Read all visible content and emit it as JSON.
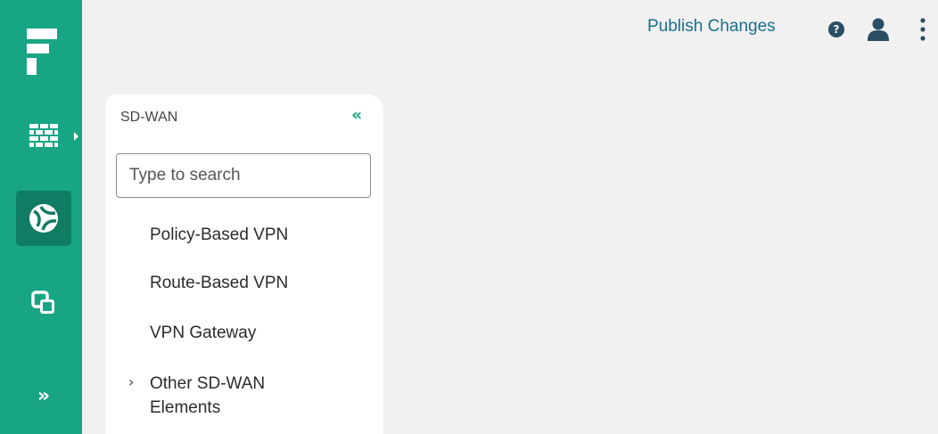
{
  "app": {
    "accent_color": "#17a584",
    "rail_active_color": "#107c63",
    "link_color": "#1a6f8c"
  },
  "rail": {
    "logo_icon": "forcepoint-logo-icon",
    "items": [
      {
        "icon": "firewall-icon",
        "active": false
      },
      {
        "icon": "globe-icon",
        "active": true
      },
      {
        "icon": "copy-icon",
        "active": false
      }
    ],
    "expand_label": "»"
  },
  "topbar": {
    "publish_label": "Publish Changes",
    "help_label": "?",
    "user_icon": "user-icon",
    "more_icon": "more-vertical-icon"
  },
  "panel": {
    "title": "SD-WAN",
    "collapse_label": "«",
    "search": {
      "placeholder": "Type to search",
      "value": ""
    },
    "items": [
      {
        "label": "Policy-Based VPN"
      },
      {
        "label": "Route-Based VPN"
      },
      {
        "label": "VPN Gateway"
      }
    ],
    "group": {
      "chevron": "›",
      "label": "Other SD-WAN Elements"
    }
  }
}
